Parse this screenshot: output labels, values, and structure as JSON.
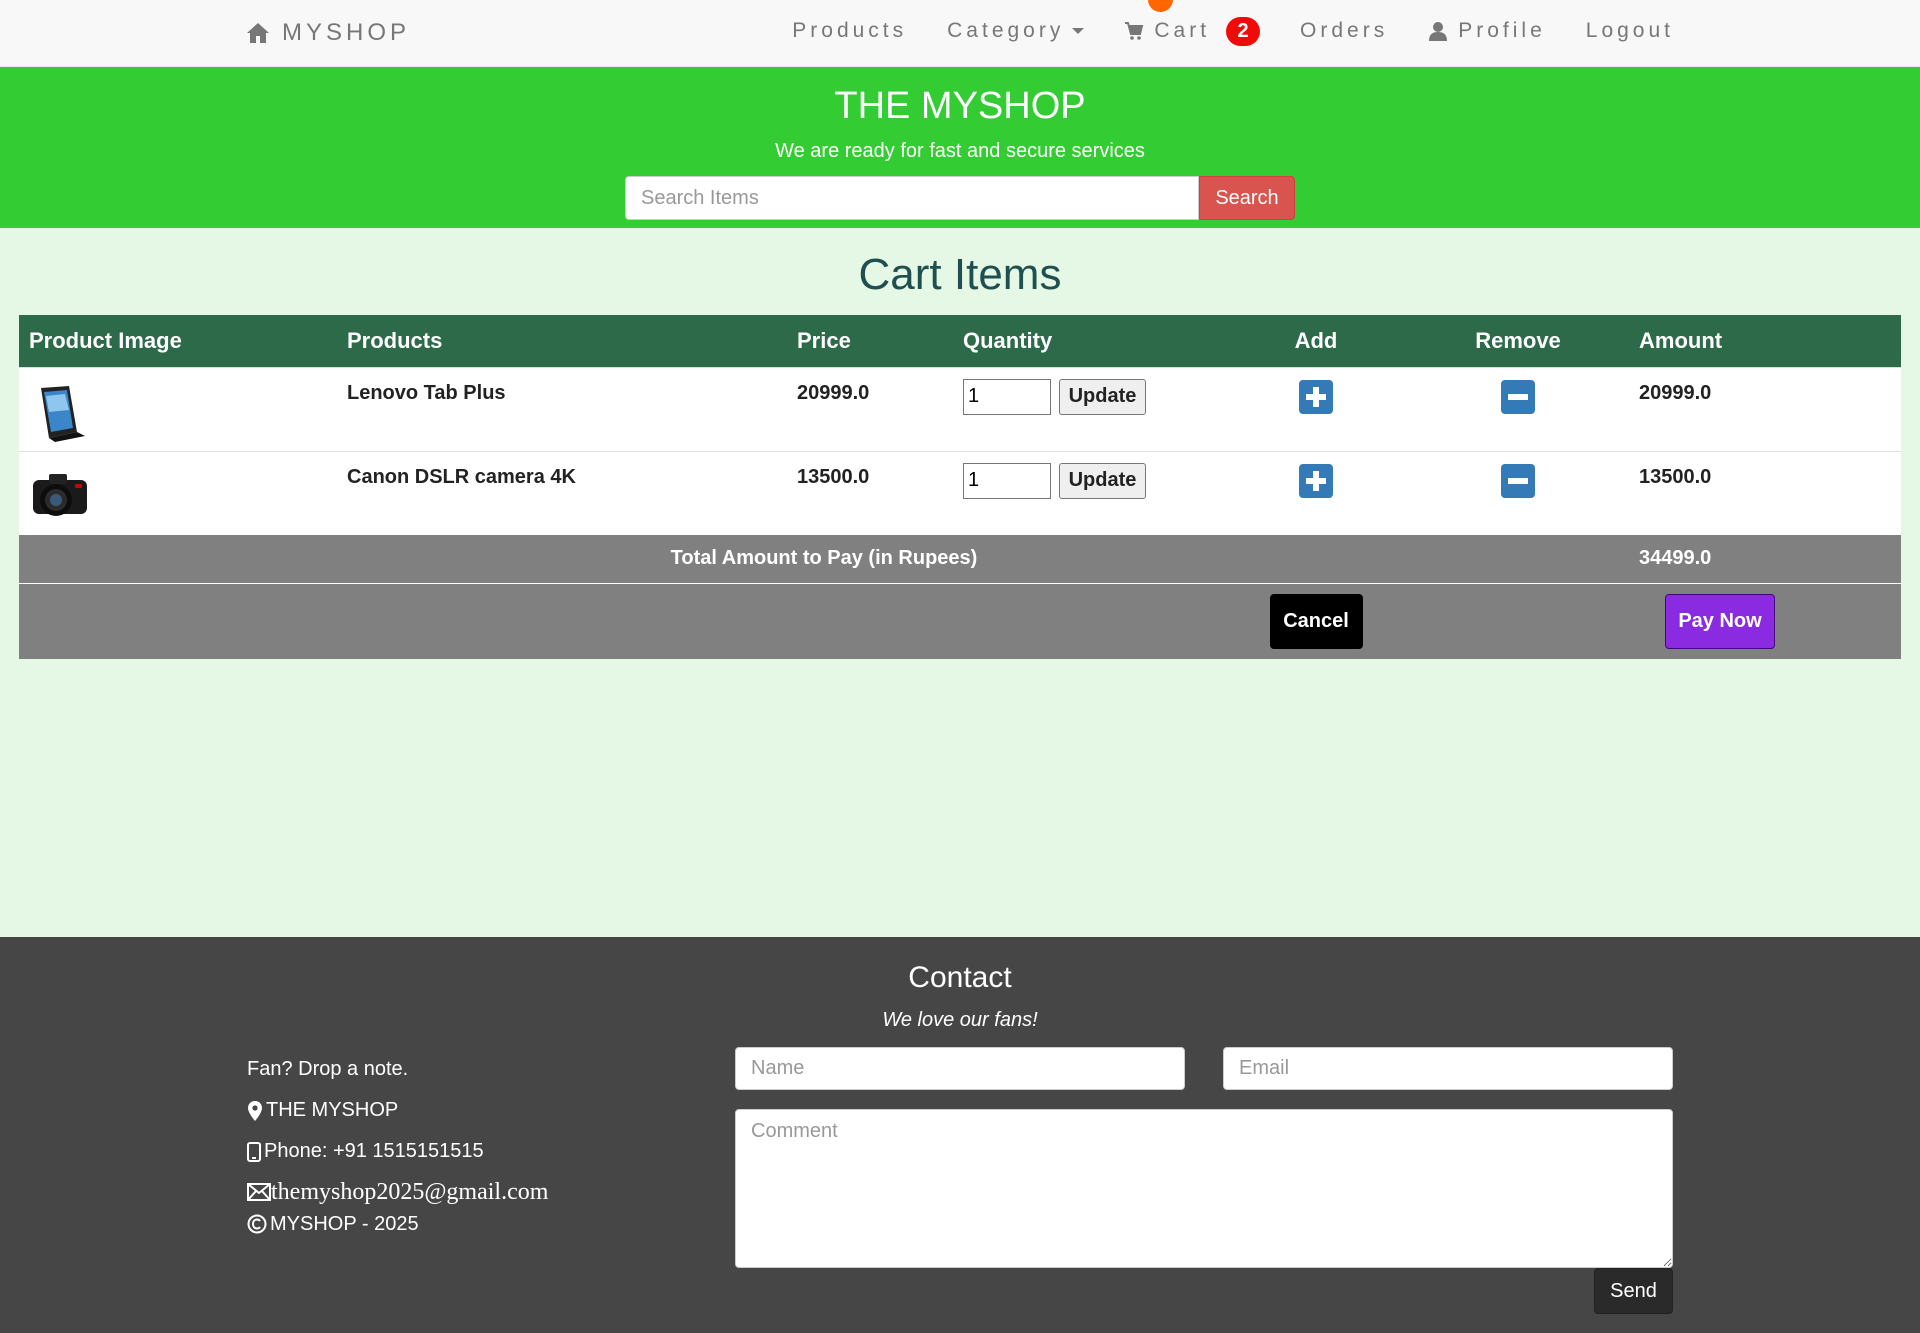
{
  "navbar": {
    "brand": "MYSHOP",
    "items": [
      {
        "label": "Products"
      },
      {
        "label": "Category"
      },
      {
        "label": "Cart",
        "badge": "2"
      },
      {
        "label": "Orders"
      },
      {
        "label": "Profile"
      },
      {
        "label": "Logout"
      }
    ]
  },
  "jumbotron": {
    "title": "THE MYSHOP",
    "subtitle": "We are ready for fast and secure services",
    "search_placeholder": "Search Items",
    "search_button": "Search"
  },
  "cart": {
    "title": "Cart Items",
    "columns": [
      "Product Image",
      "Products",
      "Price",
      "Quantity",
      "Add",
      "Remove",
      "Amount"
    ],
    "update_label": "Update",
    "rows": [
      {
        "image": "tablet-image",
        "product": "Lenovo Tab Plus",
        "price": "20999.0",
        "quantity": "1",
        "amount": "20999.0"
      },
      {
        "image": "camera-image",
        "product": "Canon DSLR camera 4K",
        "price": "13500.0",
        "quantity": "1",
        "amount": "13500.0"
      }
    ],
    "total_label": "Total Amount to Pay (in Rupees)",
    "total_value": "34499.0",
    "cancel_label": "Cancel",
    "pay_label": "Pay Now"
  },
  "footer": {
    "title": "Contact",
    "tagline": "We love our fans!",
    "note": "Fan? Drop a note.",
    "shop_name": "THE MYSHOP",
    "phone": "Phone: +91 1515151515",
    "email": "themyshop2025@gmail.com",
    "copyright": "MYSHOP - 2025",
    "name_placeholder": "Name",
    "email_placeholder": "Email",
    "comment_placeholder": "Comment",
    "send_label": "Send"
  },
  "colors": {
    "jumbotron_bg": "#33cc33",
    "page_bg": "#e5f7e5",
    "table_header_bg": "#2d6a4a",
    "total_bg": "#808080",
    "footer_bg": "#464646",
    "badge_red": "#f00a0a",
    "search_button": "#d9534f",
    "pay_button": "#8a2be2",
    "action_icon": "#337ab7"
  },
  "icons": [
    "home-icon",
    "cart-icon",
    "user-icon",
    "map-marker-icon",
    "phone-icon",
    "envelope-icon",
    "copyright-icon",
    "plus-icon",
    "minus-icon"
  ]
}
